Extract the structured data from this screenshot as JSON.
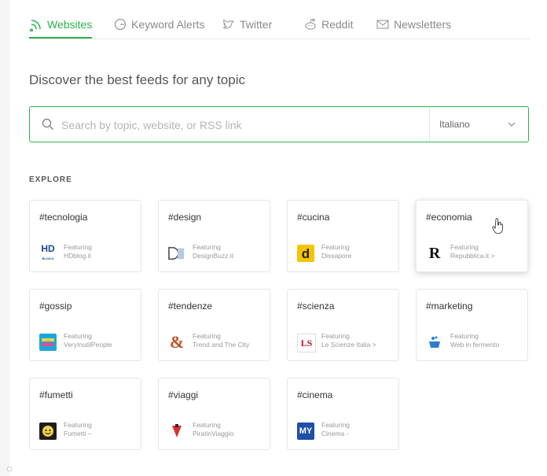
{
  "tabs": [
    {
      "label": "Websites",
      "icon": "rss-icon",
      "active": true
    },
    {
      "label": "Keyword Alerts",
      "icon": "google-icon",
      "active": false
    },
    {
      "label": "Twitter",
      "icon": "twitter-icon",
      "active": false
    },
    {
      "label": "Reddit",
      "icon": "reddit-icon",
      "active": false
    },
    {
      "label": "Newsletters",
      "icon": "mail-icon",
      "active": false
    }
  ],
  "headline": "Discover the best feeds for any topic",
  "search": {
    "placeholder": "Search by topic, website, or RSS link",
    "language": "Italiano"
  },
  "explore_label": "EXPLORE",
  "featuring_label": "Featuring",
  "cards": [
    {
      "tag": "#tecnologia",
      "site": "HDblog.it",
      "logo": "hdblog-logo"
    },
    {
      "tag": "#design",
      "site": "DesignBuzz.it",
      "logo": "designbuzz-logo"
    },
    {
      "tag": "#cucina",
      "site": "Dissapore",
      "logo": "dissapore-logo"
    },
    {
      "tag": "#economia",
      "site": "Repubblica.it >",
      "logo": "repubblica-logo"
    },
    {
      "tag": "#gossip",
      "site": "VeryInutilPeople",
      "logo": "veryinutilpeople-logo"
    },
    {
      "tag": "#tendenze",
      "site": "Trend and The City",
      "logo": "trendandthecity-logo"
    },
    {
      "tag": "#scienza",
      "site": "Le Scienze Italia >",
      "logo": "lescienze-logo"
    },
    {
      "tag": "#marketing",
      "site": "Web in fermento",
      "logo": "webinfermento-logo"
    },
    {
      "tag": "#fumetti",
      "site": "Fumetti –",
      "logo": "fumetti-logo"
    },
    {
      "tag": "#viaggi",
      "site": "PiratinViaggio",
      "logo": "piratinviaggio-logo"
    },
    {
      "tag": "#cinema",
      "site": "Cinema -",
      "logo": "cinema-logo"
    }
  ],
  "colors": {
    "accent": "#2bb24c"
  },
  "logo_texts": {
    "hdblog": "HD",
    "hdblog_sub": "BLOG.it",
    "dissapore": "d",
    "repubblica": "R",
    "lescienze": "LS",
    "cinema": "MY"
  }
}
